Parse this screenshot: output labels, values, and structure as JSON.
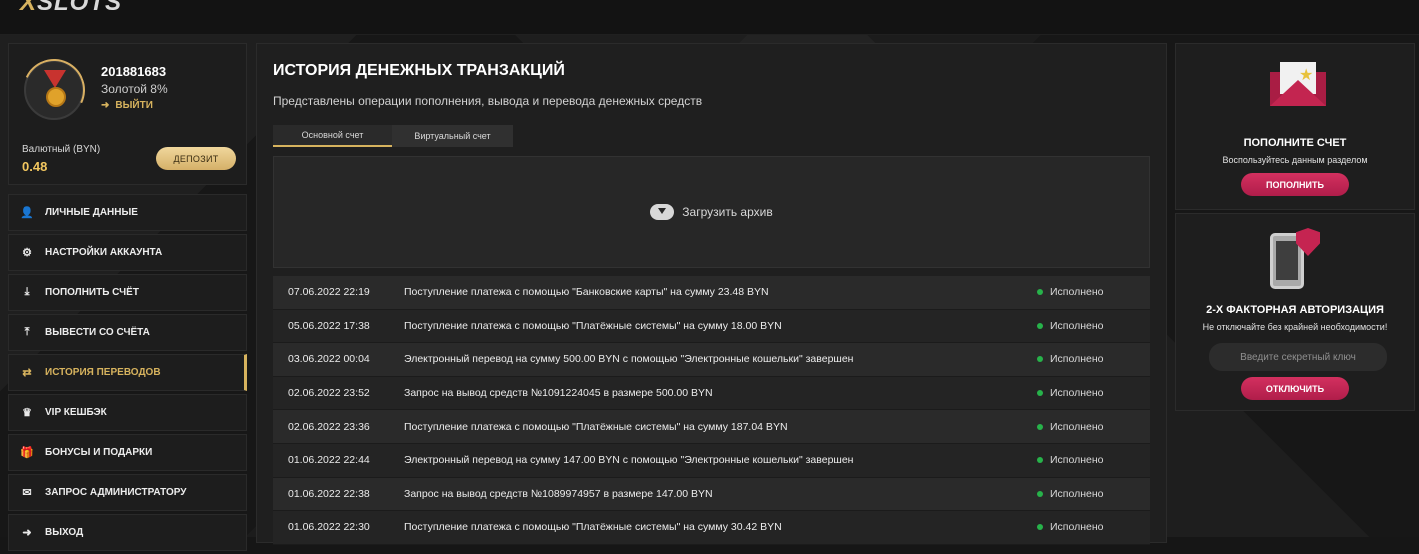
{
  "header": {
    "logo_x": "X",
    "logo_rest": "SLOTS"
  },
  "profile": {
    "user_id": "201881683",
    "level": "Золотой 8%",
    "logout_label": "ВЫЙТИ",
    "currency_label": "Валютный (BYN)",
    "balance": "0.48",
    "deposit_label": "ДЕПОЗИТ"
  },
  "menu": {
    "items": [
      {
        "label": "ЛИЧНЫЕ ДАННЫЕ",
        "icon": "user-plus-icon"
      },
      {
        "label": "НАСТРОЙКИ АККАУНТА",
        "icon": "gears-icon"
      },
      {
        "label": "ПОПОЛНИТЬ СЧЁТ",
        "icon": "download-icon"
      },
      {
        "label": "ВЫВЕСТИ СО СЧЁТА",
        "icon": "upload-icon"
      },
      {
        "label": "ИСТОРИЯ ПЕРЕВОДОВ",
        "icon": "transfer-arrows-icon"
      },
      {
        "label": "VIP КЕШБЭК",
        "icon": "crown-icon"
      },
      {
        "label": "БОНУСЫ И ПОДАРКИ",
        "icon": "gift-icon"
      },
      {
        "label": "ЗАПРОС АДМИНИСТРАТОРУ",
        "icon": "envelope-icon"
      },
      {
        "label": "ВЫХОД",
        "icon": "logout-icon"
      }
    ]
  },
  "main": {
    "title": "ИСТОРИЯ ДЕНЕЖНЫХ ТРАНЗАКЦИЙ",
    "subtitle": "Представлены операции пополнения, вывода и перевода денежных средств",
    "tabs": [
      {
        "label": "Основной счет"
      },
      {
        "label": "Виртуальный счет"
      }
    ],
    "archive_label": "Загрузить архив",
    "transactions": [
      {
        "date": "07.06.2022 22:19",
        "description": "Поступление платежа с помощью \"Банковские карты\" на сумму 23.48 BYN",
        "status": "Исполнено"
      },
      {
        "date": "05.06.2022 17:38",
        "description": "Поступление платежа с помощью \"Платёжные системы\" на сумму 18.00 BYN",
        "status": "Исполнено"
      },
      {
        "date": "03.06.2022 00:04",
        "description": "Электронный перевод на сумму 500.00 BYN с помощью \"Электронные кошельки\" завершен",
        "status": "Исполнено"
      },
      {
        "date": "02.06.2022 23:52",
        "description": "Запрос на вывод средств №1091224045 в размере 500.00 BYN",
        "status": "Исполнено"
      },
      {
        "date": "02.06.2022 23:36",
        "description": "Поступление платежа с помощью \"Платёжные системы\" на сумму 187.04 BYN",
        "status": "Исполнено"
      },
      {
        "date": "01.06.2022 22:44",
        "description": "Электронный перевод на сумму 147.00 BYN с помощью \"Электронные кошельки\" завершен",
        "status": "Исполнено"
      },
      {
        "date": "01.06.2022 22:38",
        "description": "Запрос на вывод средств №1089974957 в размере 147.00 BYN",
        "status": "Исполнено"
      },
      {
        "date": "01.06.2022 22:30",
        "description": "Поступление платежа с помощью \"Платёжные системы\" на сумму 30.42 BYN",
        "status": "Исполнено"
      }
    ]
  },
  "right": {
    "topup": {
      "title": "ПОПОЛНИТЕ СЧЕТ",
      "text": "Воспользуйтесь данным разделом",
      "button": "ПОПОЛНИТЬ"
    },
    "twofa": {
      "title": "2-Х ФАКТОРНАЯ АВТОРИЗАЦИЯ",
      "text": "Не отключайте без крайней необходимости!",
      "placeholder": "Введите секретный ключ",
      "button": "ОТКЛЮЧИТЬ"
    }
  },
  "colors": {
    "accent": "#d7b35e",
    "pink": "#c52451",
    "status_ok": "#27b24a"
  }
}
